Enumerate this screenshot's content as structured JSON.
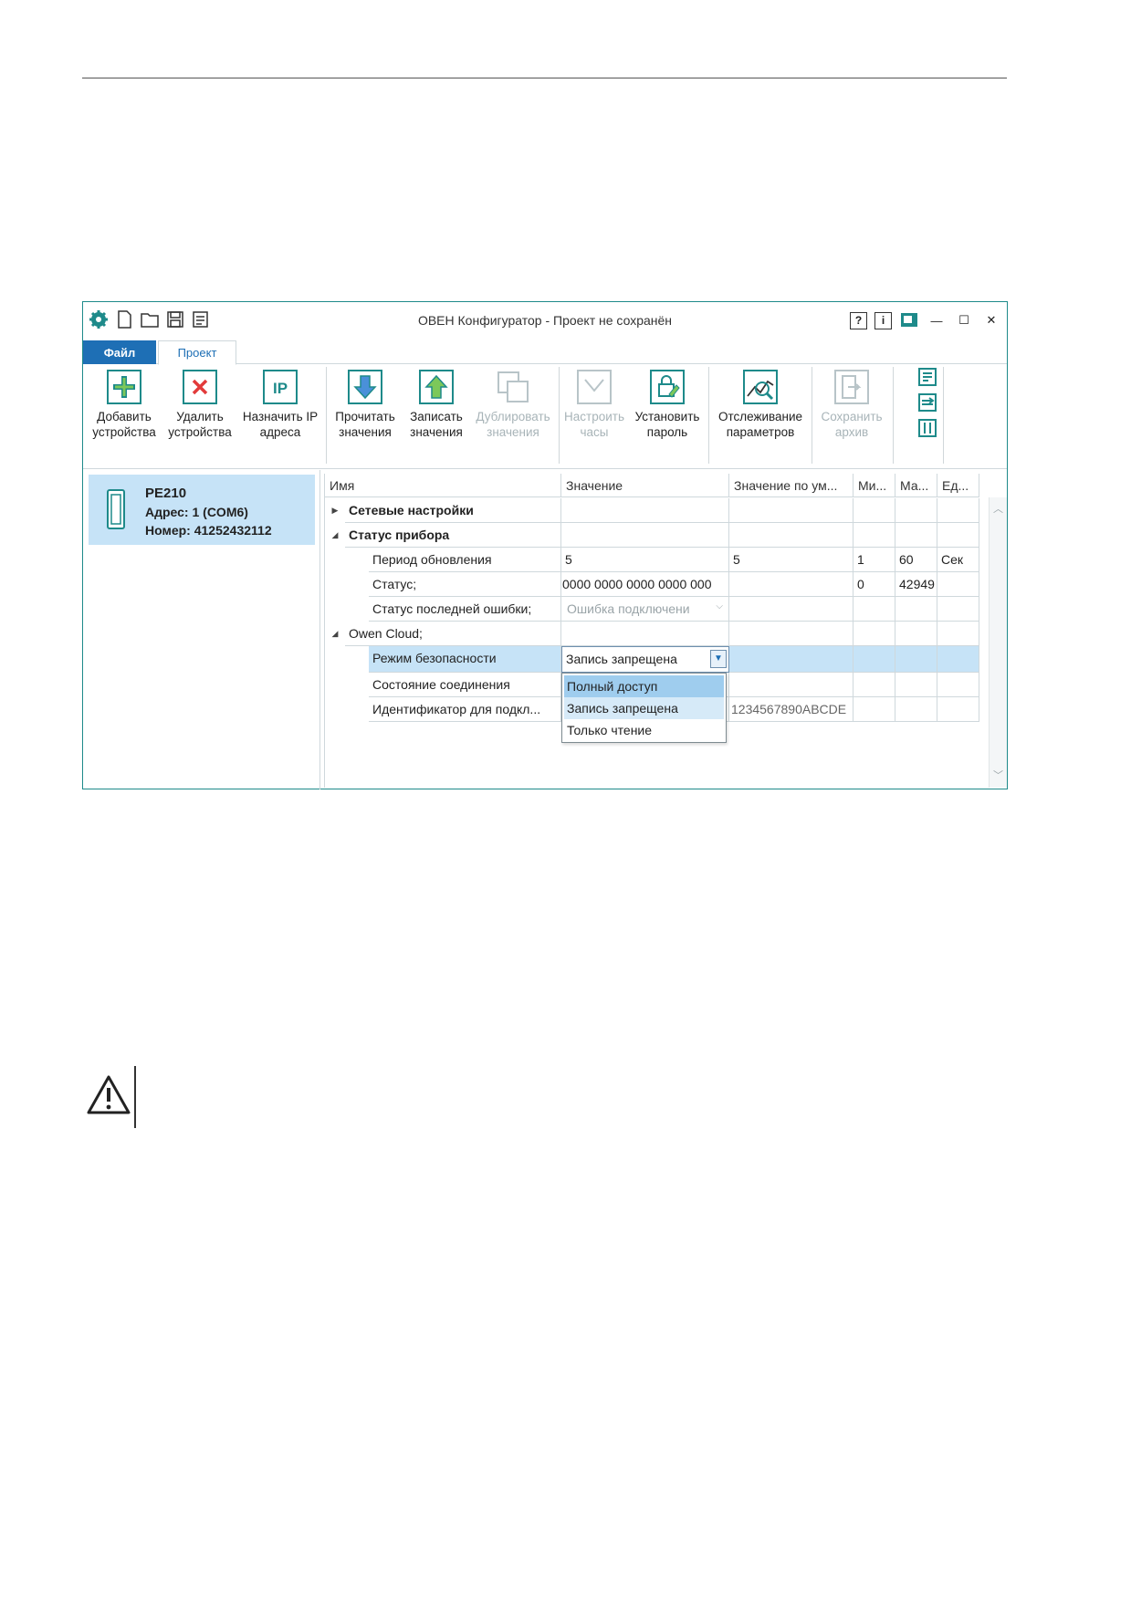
{
  "window": {
    "title": "ОВЕН Конфигуратор - Проект не сохранён",
    "controls": {
      "help": "?",
      "info": "i",
      "minimize": "—",
      "maximize": "☐",
      "close": "✕"
    }
  },
  "menu": {
    "file_tab": "Файл",
    "project_tab": "Проект"
  },
  "ribbon": {
    "add_devices": [
      "Добавить",
      "устройства"
    ],
    "remove_devices": [
      "Удалить",
      "устройства"
    ],
    "assign_ip": [
      "Назначить IP",
      "адреса"
    ],
    "assign_ip_icon_text": "IP",
    "read_values": [
      "Прочитать",
      "значения"
    ],
    "write_values": [
      "Записать",
      "значения"
    ],
    "duplicate_values": [
      "Дублировать",
      "значения"
    ],
    "set_clock": [
      "Настроить",
      "часы"
    ],
    "set_password": [
      "Установить",
      "пароль"
    ],
    "track_params": [
      "Отслеживание",
      "параметров"
    ],
    "save_archive": [
      "Сохранить",
      "архив"
    ]
  },
  "device": {
    "name": "PE210",
    "address": "Адрес: 1 (COM6)",
    "number": "Номер: 41252432112"
  },
  "grid": {
    "columns": [
      "Имя",
      "Значение",
      "Значение по ум...",
      "Ми...",
      "Ма...",
      "Ед..."
    ],
    "rows": [
      {
        "name": "Сетевые настройки",
        "value": "",
        "default": "",
        "min": "",
        "max": "",
        "unit": ""
      },
      {
        "name": "Статус прибора",
        "value": "",
        "default": "",
        "min": "",
        "max": "",
        "unit": ""
      },
      {
        "name": "Период обновления",
        "value": "5",
        "default": "5",
        "min": "1",
        "max": "60",
        "unit": "Сек"
      },
      {
        "name": "Статус;",
        "value": "0000 0000 0000 0000 000",
        "default": "",
        "min": "0",
        "max": "42949",
        "unit": ""
      },
      {
        "name": "Статус последней ошибки;",
        "value": "Ошибка подключени",
        "default": "",
        "min": "",
        "max": "",
        "unit": ""
      },
      {
        "name": "Owen Cloud;",
        "value": "",
        "default": "",
        "min": "",
        "max": "",
        "unit": ""
      },
      {
        "name": "Режим безопасности",
        "value": "Запись запрещена",
        "default": "",
        "min": "",
        "max": "",
        "unit": ""
      },
      {
        "name": "Состояние соединения",
        "value": "",
        "default": "",
        "min": "",
        "max": "",
        "unit": ""
      },
      {
        "name": "Идентификатор для подкл...",
        "value": "",
        "default": "1234567890ABCDE",
        "min": "",
        "max": "",
        "unit": ""
      }
    ]
  },
  "dropdown": {
    "options": [
      "Полный доступ",
      "Запись запрещена",
      "Только чтение"
    ],
    "selected": "Запись запрещена"
  },
  "icons": [
    "app-gear-icon",
    "new-file-icon",
    "open-folder-icon",
    "save-icon",
    "save-as-icon",
    "warning-icon"
  ]
}
